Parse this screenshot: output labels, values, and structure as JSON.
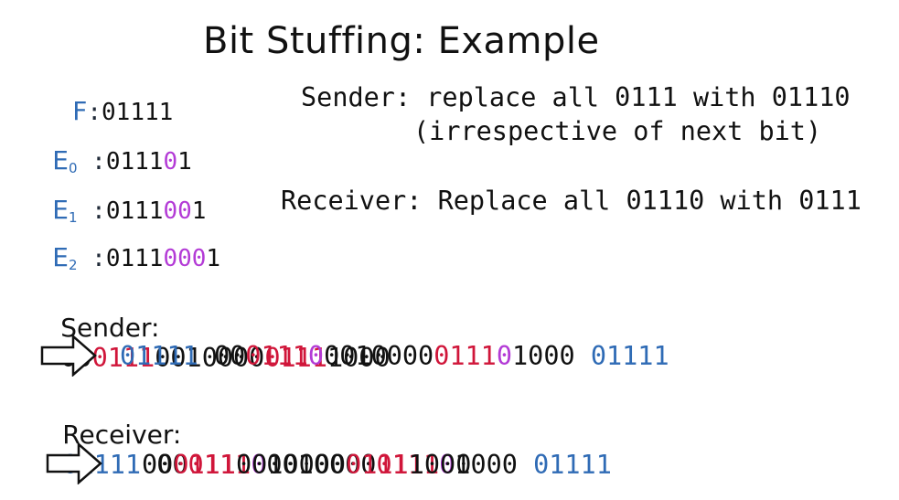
{
  "title": "Bit Stuffing: Example",
  "flags": [
    {
      "label": "F",
      "sub": "",
      "bits": [
        {
          "t": "01111",
          "c": "black"
        }
      ]
    },
    {
      "label": "E",
      "sub": "0",
      "bits": [
        {
          "t": "0111",
          "c": "black"
        },
        {
          "t": "0",
          "c": "purple"
        },
        {
          "t": "1",
          "c": "black"
        }
      ]
    },
    {
      "label": "E",
      "sub": "1",
      "bits": [
        {
          "t": "0111",
          "c": "black"
        },
        {
          "t": "00",
          "c": "purple"
        },
        {
          "t": "1",
          "c": "black"
        }
      ]
    },
    {
      "label": "E",
      "sub": "2",
      "bits": [
        {
          "t": "0111",
          "c": "black"
        },
        {
          "t": "000",
          "c": "purple"
        },
        {
          "t": "1",
          "c": "black"
        }
      ]
    }
  ],
  "rules": {
    "sender": "Sender: replace all 0111 with 01110",
    "sender_note": "(irrespective of next bit)",
    "receiver": "Receiver: Replace all 01110 with 0111"
  },
  "example": {
    "sender_label": "Sender:",
    "sender_bits": [
      {
        "t": "00",
        "c": "black"
      },
      {
        "t": "0111",
        "c": "red"
      },
      {
        "t": "0010000",
        "c": "black"
      },
      {
        "t": "0111",
        "c": "red"
      },
      {
        "t": "1000",
        "c": "black"
      }
    ],
    "stuffed_bits": [
      {
        "t": "01111 ",
        "c": "blue"
      },
      {
        "t": "00",
        "c": "black"
      },
      {
        "t": "0111",
        "c": "red"
      },
      {
        "t": "0",
        "c": "purple"
      },
      {
        "t": "0010000",
        "c": "black"
      },
      {
        "t": "0111",
        "c": "red"
      },
      {
        "t": "0",
        "c": "purple"
      },
      {
        "t": "1000",
        "c": "black"
      },
      {
        "t": " 01111",
        "c": "blue"
      }
    ],
    "receiver_label": "Receiver:",
    "received_bits": [
      {
        "t": "01111 ",
        "c": "blue"
      },
      {
        "t": "00",
        "c": "black"
      },
      {
        "t": "0111",
        "c": "red"
      },
      {
        "t": "0",
        "c": "purple"
      },
      {
        "t": "0010000",
        "c": "black"
      },
      {
        "t": "0111",
        "c": "red"
      },
      {
        "t": "0",
        "c": "purple"
      },
      {
        "t": "1000",
        "c": "black"
      },
      {
        "t": " 01111",
        "c": "blue"
      }
    ],
    "destuffed_bits": [
      {
        "t": "00",
        "c": "black"
      },
      {
        "t": "0111",
        "c": "red"
      },
      {
        "t": "0010000",
        "c": "black"
      },
      {
        "t": "0111",
        "c": "red"
      },
      {
        "t": "1000",
        "c": "black"
      }
    ]
  },
  "colors": {
    "blue": "#2f6bb5",
    "red": "#d0163a",
    "purple": "#b33bd6",
    "black": "#111111"
  }
}
